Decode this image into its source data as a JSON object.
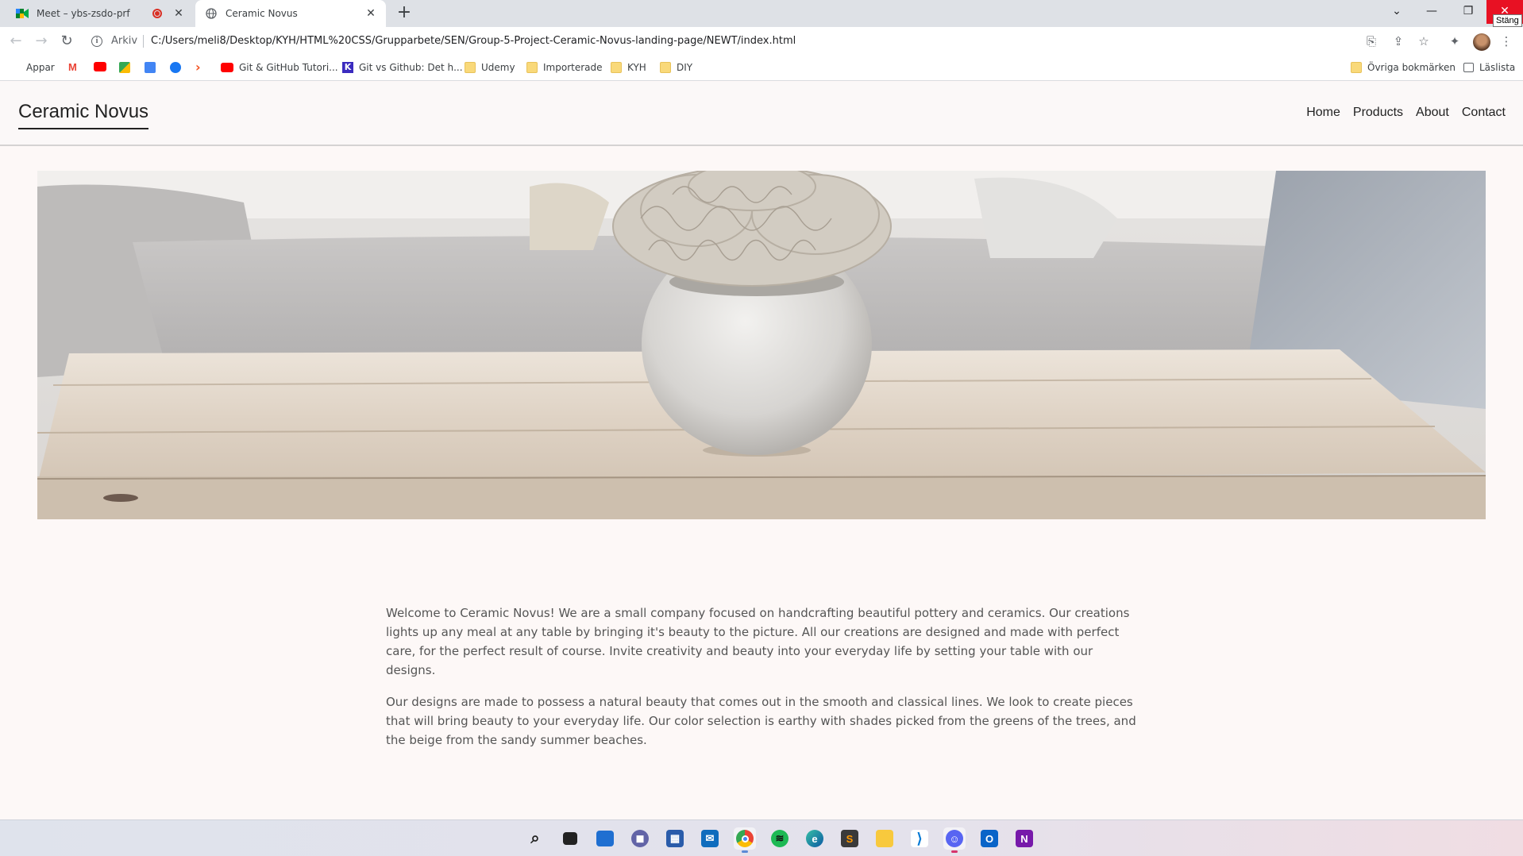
{
  "browser": {
    "tabs": [
      {
        "title": "Meet – ybs-zsdo-prf",
        "recording": true
      },
      {
        "title": "Ceramic Novus",
        "active": true
      }
    ],
    "window_tooltip": "Stäng",
    "address": {
      "security_label": "Arkiv",
      "url": "C:/Users/meli8/Desktop/KYH/HTML%20CSS/Grupparbete/SEN/Group-5-Project-Ceramic-Novus-landing-page/NEWT/index.html"
    },
    "bookmarks": {
      "apps": "Appar",
      "git_tutorial": "Git & GitHub Tutori...",
      "git_vs_github": "Git vs Github: Det h...",
      "udemy": "Udemy",
      "importerade": "Importerade",
      "kyh": "KYH",
      "diy": "DIY",
      "other": "Övriga bokmärken",
      "reading_list": "Läslista"
    }
  },
  "site": {
    "logo": "Ceramic Novus",
    "nav": [
      "Home",
      "Products",
      "About",
      "Contact"
    ],
    "paragraphs": [
      "Welcome to Ceramic Novus! We are a small company focused on handcrafting beautiful pottery and ceramics. Our creations lights up any meal at any table by bringing it's beauty to the picture. All our creations are designed and made with perfect care, for the perfect result of course. Invite creativity and beauty into your everyday life by setting your table with our designs.",
      "Our designs are made to possess a natural beauty that comes out in the smooth and classical lines. We look to create pieces that will bring beauty to your everyday life. Our color selection is earthy with shades picked from the greens of the trees, and the beige from the sandy summer beaches."
    ]
  },
  "taskbar_icons": [
    "windows-start-icon",
    "search-icon",
    "task-view-icon",
    "widgets-icon",
    "teams-chat-icon",
    "store-icon",
    "mail-icon",
    "chrome-icon",
    "spotify-icon",
    "edge-icon",
    "sublime-text-icon",
    "file-explorer-icon",
    "vscode-icon",
    "discord-icon",
    "outlook-icon",
    "onenote-icon"
  ]
}
